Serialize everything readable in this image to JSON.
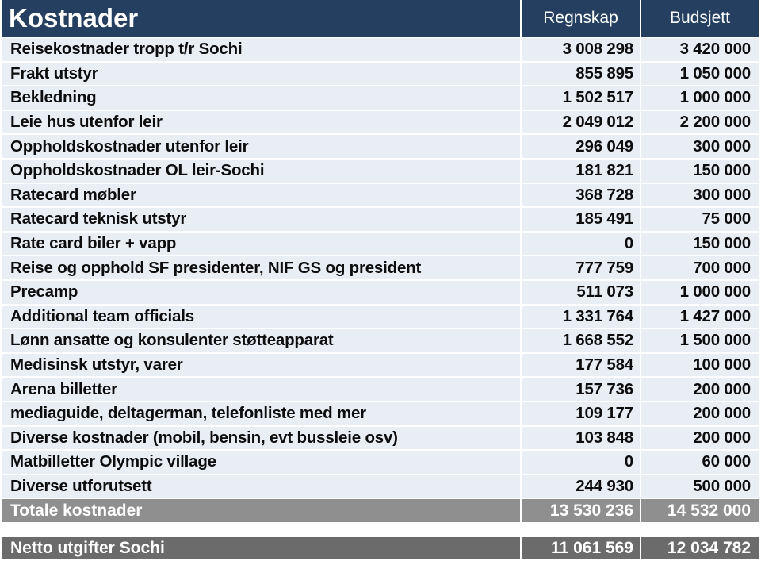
{
  "table": {
    "title": "Kostnader",
    "columns": [
      "Regnskap",
      "Budsjett"
    ],
    "rows": [
      {
        "label": "Reisekostnader tropp t/r Sochi",
        "regnskap": "3 008 298",
        "budsjett": "3 420 000"
      },
      {
        "label": "Frakt utstyr",
        "regnskap": "855 895",
        "budsjett": "1 050 000"
      },
      {
        "label": "Bekledning",
        "regnskap": "1 502 517",
        "budsjett": "1 000 000"
      },
      {
        "label": "Leie hus utenfor leir",
        "regnskap": "2 049 012",
        "budsjett": "2 200 000"
      },
      {
        "label": "Oppholdskostnader utenfor leir",
        "regnskap": "296 049",
        "budsjett": "300 000"
      },
      {
        "label": "Oppholdskostnader OL leir-Sochi",
        "regnskap": "181 821",
        "budsjett": "150 000"
      },
      {
        "label": "Ratecard møbler",
        "regnskap": "368 728",
        "budsjett": "300 000"
      },
      {
        "label": "Ratecard teknisk utstyr",
        "regnskap": "185 491",
        "budsjett": "75 000"
      },
      {
        "label": "Rate card biler + vapp",
        "regnskap": "0",
        "budsjett": "150 000"
      },
      {
        "label": "Reise og opphold SF presidenter, NIF GS og president",
        "regnskap": "777 759",
        "budsjett": "700 000"
      },
      {
        "label": "Precamp",
        "regnskap": "511 073",
        "budsjett": "1 000 000"
      },
      {
        "label": "Additional team officials",
        "regnskap": "1 331 764",
        "budsjett": "1 427 000"
      },
      {
        "label": "Lønn ansatte  og konsulenter støtteapparat",
        "regnskap": "1 668 552",
        "budsjett": "1 500 000"
      },
      {
        "label": "Medisinsk utstyr, varer",
        "regnskap": "177 584",
        "budsjett": "100 000"
      },
      {
        "label": "Arena billetter",
        "regnskap": "157 736",
        "budsjett": "200 000"
      },
      {
        "label": "mediaguide, deltagerman, telefonliste med mer",
        "regnskap": "109 177",
        "budsjett": "200 000"
      },
      {
        "label": "Diverse kostnader (mobil, bensin, evt bussleie osv)",
        "regnskap": "103 848",
        "budsjett": "200 000"
      },
      {
        "label": "Matbilletter Olympic village",
        "regnskap": "0",
        "budsjett": "60 000"
      },
      {
        "label": "Diverse utforutsett",
        "regnskap": "244 930",
        "budsjett": "500 000"
      }
    ],
    "total": {
      "label": "Totale kostnader",
      "regnskap": "13 530 236",
      "budsjett": "14 532 000"
    },
    "net": {
      "label": "Netto utgifter Sochi",
      "regnskap": "11 061 569",
      "budsjett": "12 034 782"
    }
  },
  "colors": {
    "header_bg": "#243f60",
    "row_bg": "#e9edf4",
    "total_bg": "#8f8f8f",
    "net_bg": "#6b6b6b"
  }
}
